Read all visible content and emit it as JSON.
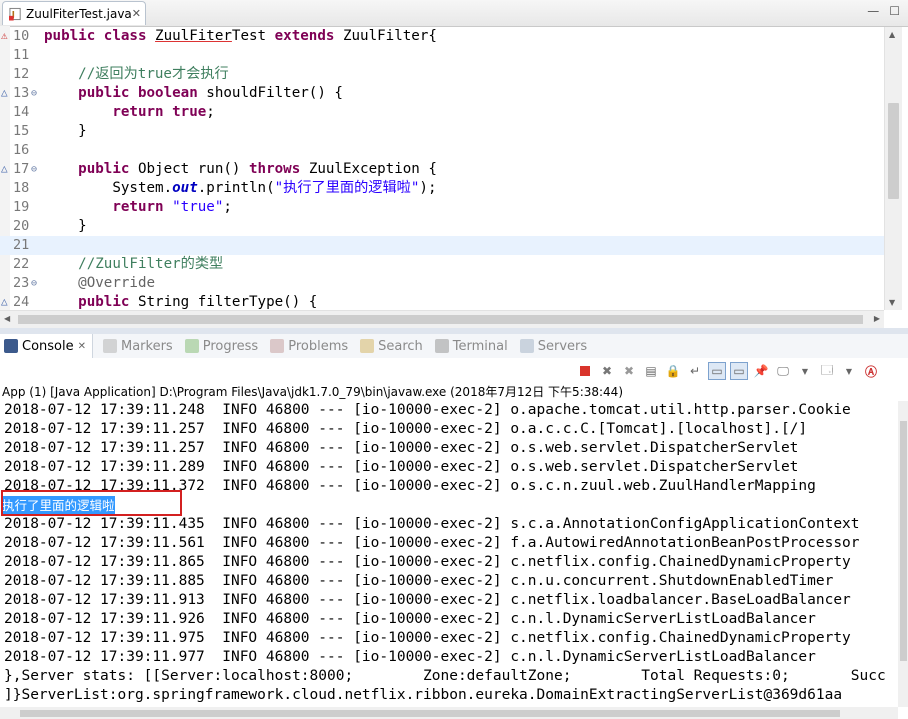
{
  "editor": {
    "tab_title": "ZuulFiterTest.java",
    "lines": [
      {
        "num": "10",
        "marker": "error"
      },
      {
        "num": "11"
      },
      {
        "num": "12"
      },
      {
        "num": "13",
        "marker": "override",
        "fold": "⊖"
      },
      {
        "num": "14"
      },
      {
        "num": "15"
      },
      {
        "num": "16"
      },
      {
        "num": "17",
        "marker": "override",
        "fold": "⊖"
      },
      {
        "num": "18"
      },
      {
        "num": "19"
      },
      {
        "num": "20"
      },
      {
        "num": "21",
        "highlight": true
      },
      {
        "num": "22"
      },
      {
        "num": "23",
        "fold": "⊖"
      },
      {
        "num": "24",
        "marker": "override"
      }
    ],
    "code": {
      "l10_kw1": "public class ",
      "l10_cls": "ZuulFiter",
      "l10_cls2": "Test",
      "l10_kw2": " extends ",
      "l10_rest": "ZuulFilter{",
      "l12_comment": "    //返回为true才会执行",
      "l13_kw": "    public boolean ",
      "l13_rest": "shouldFilter() {",
      "l14_kw": "        return true",
      "l14_rest": ";",
      "l15": "    }",
      "l17_kw": "    public ",
      "l17_a": "Object run() ",
      "l17_kw2": "throws ",
      "l17_b": "ZuulException {",
      "l18_a": "        System.",
      "l18_it": "out",
      "l18_b": ".println(",
      "l18_str": "\"执行了里面的逻辑啦\"",
      "l18_c": ");",
      "l19_kw": "        return ",
      "l19_str": "\"true\"",
      "l19_c": ";",
      "l20": "    }",
      "l22_comment": "    //ZuulFilter的类型",
      "l23_ann": "    @Override",
      "l24_kw": "    public ",
      "l24_rest": "String filterType() {"
    }
  },
  "console": {
    "tabs": [
      {
        "label": "Console",
        "active": true,
        "icon": "console-icon"
      },
      {
        "label": "Markers",
        "icon": "markers-icon"
      },
      {
        "label": "Progress",
        "icon": "progress-icon"
      },
      {
        "label": "Problems",
        "icon": "problems-icon"
      },
      {
        "label": "Search",
        "icon": "search-icon"
      },
      {
        "label": "Terminal",
        "icon": "terminal-icon"
      },
      {
        "label": "Servers",
        "icon": "servers-icon"
      }
    ],
    "process_label": "App (1) [Java Application] D:\\Program Files\\Java\\jdk1.7.0_79\\bin\\javaw.exe (2018年7月12日 下午5:38:44)",
    "lines": [
      "2018-07-12 17:39:11.248  INFO 46800 --- [io-10000-exec-2] o.apache.tomcat.util.http.parser.Cookie",
      "2018-07-12 17:39:11.257  INFO 46800 --- [io-10000-exec-2] o.a.c.c.C.[Tomcat].[localhost].[/]",
      "2018-07-12 17:39:11.257  INFO 46800 --- [io-10000-exec-2] o.s.web.servlet.DispatcherServlet",
      "2018-07-12 17:39:11.289  INFO 46800 --- [io-10000-exec-2] o.s.web.servlet.DispatcherServlet",
      "2018-07-12 17:39:11.372  INFO 46800 --- [io-10000-exec-2] o.s.c.n.zuul.web.ZuulHandlerMapping",
      "执行了里面的逻辑啦",
      "2018-07-12 17:39:11.435  INFO 46800 --- [io-10000-exec-2] s.c.a.AnnotationConfigApplicationContext",
      "2018-07-12 17:39:11.561  INFO 46800 --- [io-10000-exec-2] f.a.AutowiredAnnotationBeanPostProcessor",
      "2018-07-12 17:39:11.865  INFO 46800 --- [io-10000-exec-2] c.netflix.config.ChainedDynamicProperty",
      "2018-07-12 17:39:11.885  INFO 46800 --- [io-10000-exec-2] c.n.u.concurrent.ShutdownEnabledTimer",
      "2018-07-12 17:39:11.913  INFO 46800 --- [io-10000-exec-2] c.netflix.loadbalancer.BaseLoadBalancer",
      "2018-07-12 17:39:11.926  INFO 46800 --- [io-10000-exec-2] c.n.l.DynamicServerListLoadBalancer",
      "2018-07-12 17:39:11.975  INFO 46800 --- [io-10000-exec-2] c.netflix.config.ChainedDynamicProperty",
      "2018-07-12 17:39:11.977  INFO 46800 --- [io-10000-exec-2] c.n.l.DynamicServerListLoadBalancer",
      "},Server stats: [[Server:localhost:8000;        Zone:defaultZone;        Total Requests:0;       Succ",
      "]}ServerList:org.springframework.cloud.netflix.ribbon.eureka.DomainExtractingServerList@369d61aa"
    ],
    "selected_line_index": 5
  }
}
